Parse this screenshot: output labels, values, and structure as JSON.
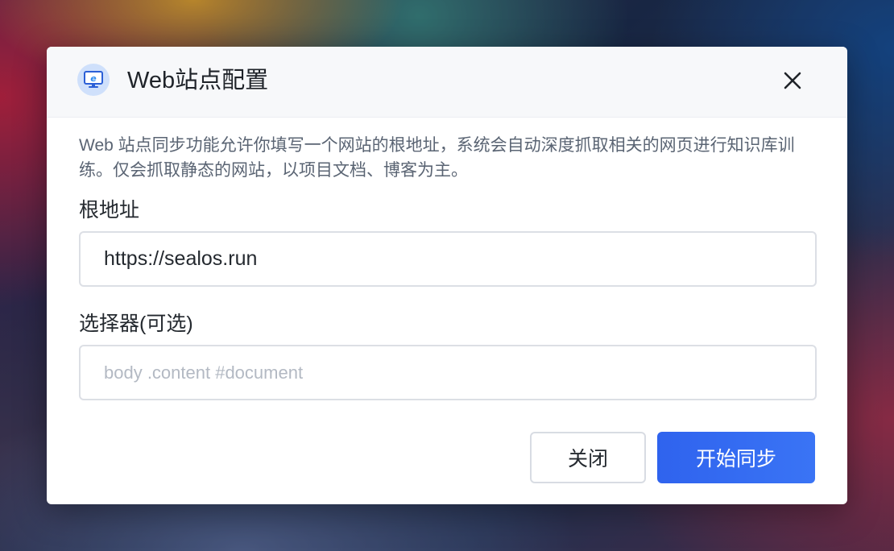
{
  "dialog": {
    "title": "Web站点配置",
    "icon": "web-monitor-icon",
    "close_icon": "close-icon",
    "description": "Web 站点同步功能允许你填写一个网站的根地址，系统会自动深度抓取相关的网页进行知识库训练。仅会抓取静态的网站，以项目文档、博客为主。"
  },
  "form": {
    "root_url": {
      "label": "根地址",
      "value": "https://sealos.run"
    },
    "selector": {
      "label": "选择器(可选)",
      "value": "",
      "placeholder": "body .content #document"
    }
  },
  "footer": {
    "close_label": "关闭",
    "start_label": "开始同步"
  },
  "colors": {
    "primary": "#3370ff",
    "icon_bg": "#cfe0fb"
  }
}
